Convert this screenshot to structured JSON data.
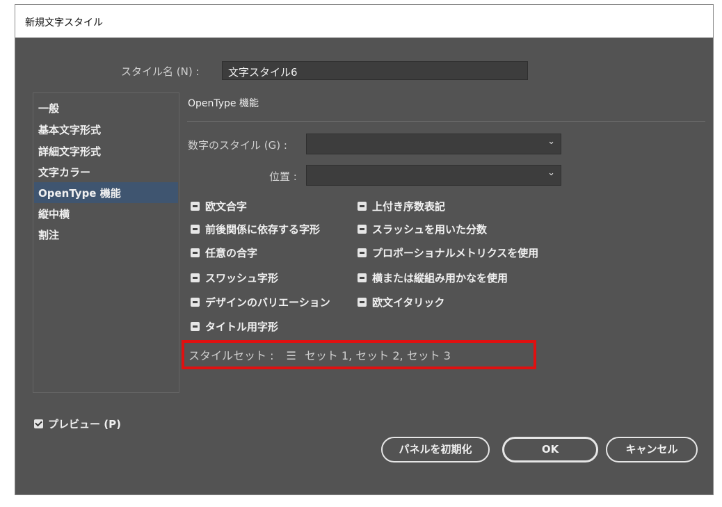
{
  "window": {
    "title": "新規文字スタイル"
  },
  "style_name": {
    "label": "スタイル名 (N) :",
    "value": "文字スタイル6"
  },
  "sidebar": {
    "items": [
      {
        "label": "一般"
      },
      {
        "label": "基本文字形式"
      },
      {
        "label": "詳細文字形式"
      },
      {
        "label": "文字カラー"
      },
      {
        "label": "OpenType 機能",
        "selected": true
      },
      {
        "label": "縦中横"
      },
      {
        "label": "割注"
      }
    ]
  },
  "section": {
    "title": "OpenType 機能"
  },
  "figure_style": {
    "label": "数字のスタイル (G) :",
    "value": ""
  },
  "position": {
    "label": "位置 :",
    "value": ""
  },
  "features": {
    "left": [
      {
        "label": "欧文合字"
      },
      {
        "label": "前後関係に依存する字形"
      },
      {
        "label": "任意の合字"
      },
      {
        "label": "スワッシュ字形"
      },
      {
        "label": "デザインのバリエーション"
      },
      {
        "label": "タイトル用字形"
      }
    ],
    "right": [
      {
        "label": "上付き序数表記"
      },
      {
        "label": "スラッシュを用いた分数"
      },
      {
        "label": "プロポーショナルメトリクスを使用"
      },
      {
        "label": "横または縦組み用かなを使用"
      },
      {
        "label": "欧文イタリック"
      }
    ],
    "state": "mixed"
  },
  "style_set": {
    "label": "スタイルセット :",
    "icon": "list-icon",
    "value": "セット 1, セット 2, セット 3"
  },
  "preview": {
    "label": "プレビュー (P)",
    "checked": true
  },
  "buttons": {
    "reset": "パネルを初期化",
    "ok": "OK",
    "cancel": "キャンセル"
  },
  "colors": {
    "dialog_bg": "#535353",
    "highlight": "#e01010",
    "selected": "#3f5570"
  }
}
